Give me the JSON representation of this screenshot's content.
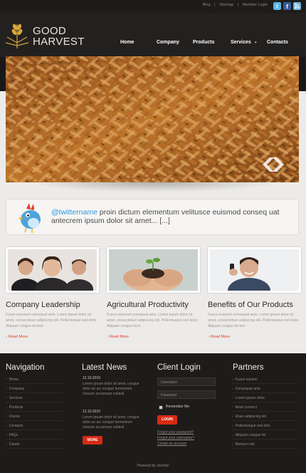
{
  "top_links": {
    "blog": "Blog",
    "sitemap": "Sitemap",
    "member_login": "Member Login",
    "separator": "|"
  },
  "brand": {
    "line1": "GOOD",
    "line2": "HARVEST"
  },
  "nav": {
    "home": "Home",
    "company": "Company",
    "products": "Products",
    "services": "Services",
    "contacts": "Contacts",
    "services_caret": "▾"
  },
  "tweet": {
    "handle": "@twittername",
    "text": " proin dictum elementum velitusce euismod conseq uat antecrem ipsum dolor sit amet... [...]"
  },
  "features": [
    {
      "title": "Company Leadership",
      "desc": "Fusce euismod consequat ante. Lorem ipsum dolor sit amet, consectetuer adipiscing elit. Pellentesque sed dolor. Aliquam congue fermen",
      "readmore": "Read More"
    },
    {
      "title": "Agricultural Productivity",
      "desc": "Fusce euismod consequat ante. Lorem ipsum dolor sit amet, consectetuer adipiscing elit. Pellentesque sed dolor. Aliquam congue ferm",
      "readmore": "Read More"
    },
    {
      "title": "Benefits of Our Products",
      "desc": "Fusce euismod consequat ante. Lorem ipsum dolor sit amet, consectetuer adipiscing elit. Pellentesque sed dolor. Aliquam congue fermen",
      "readmore": "Read More"
    }
  ],
  "footer": {
    "navigation": {
      "title": "Navigation",
      "items": [
        "Home",
        "Company",
        "Services",
        "Products",
        "Clients",
        "Contacts",
        "FAQs",
        "Career"
      ]
    },
    "news": {
      "title": "Latest News",
      "items": [
        {
          "date": "12.10.2010",
          "text": "Lorem ipsum dolor sit amet, congue dolor un arc congue fermentum nisisuro accumsan nullavil."
        },
        {
          "date": "12.10.2010",
          "text": "Lorem ipsum dolor sit amet, congue dolor un arc congue fermentum nisisuro accumsan nullavil."
        }
      ],
      "more_button": "MORE"
    },
    "login": {
      "title": "Client Login",
      "username_placeholder": "Username",
      "password_placeholder": "Password",
      "remember": "Remember Me",
      "login_button": "LOGIN",
      "forgot_password": "Forgot your password?",
      "forgot_username": "Forgot your username?",
      "create_account": "Create an account"
    },
    "partners": {
      "title": "Partners",
      "items": [
        "Fusce euismo",
        "Consequat ante",
        "Lorem ipsum dolor",
        "Amet consect",
        "Etuer adipiscing elit",
        "Pellentesque sed dolo",
        "Aliquam congue fer",
        "Mentum nisl"
      ]
    },
    "powered_by": "Powered by Joomla!"
  },
  "colors": {
    "accent_red": "#d62b13",
    "twitter_blue": "#2d9ad8",
    "header_bg": "#232120"
  },
  "icons": {
    "logo": "wheat-icon",
    "social_1": "twitter-icon",
    "social_2": "facebook-icon",
    "social_3": "rss-icon",
    "slider_next": "slider-next-icon",
    "tweet_bird": "bird-icon"
  }
}
